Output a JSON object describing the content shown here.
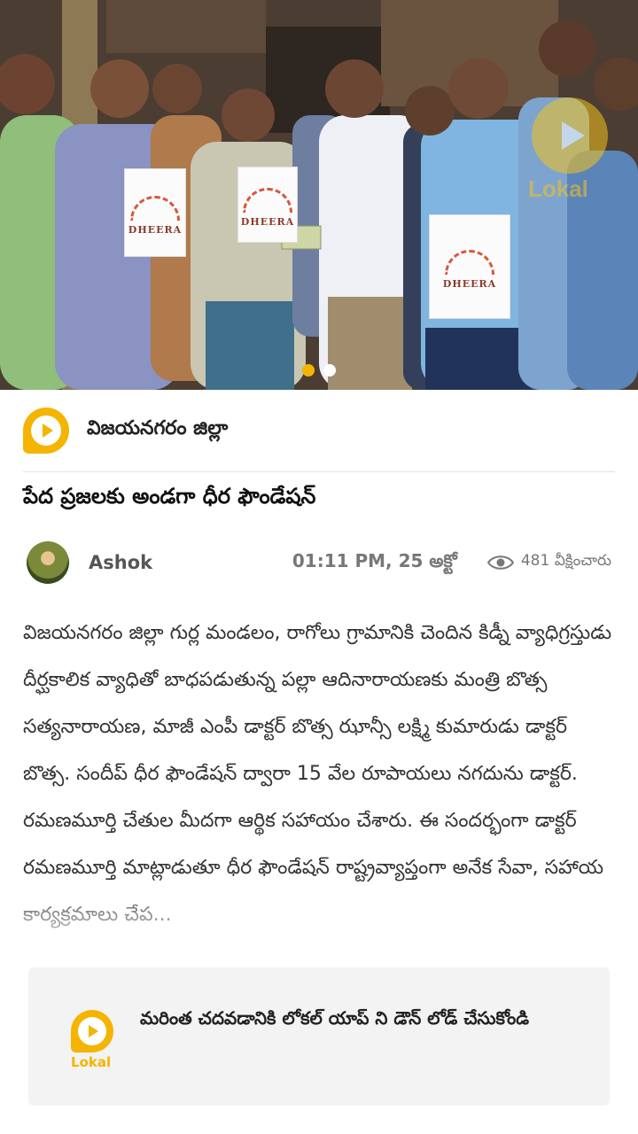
{
  "photo": {
    "description_alt": "",
    "paper_text": "DHEERA",
    "watermark_label": "Lokal",
    "carousel_count": 2,
    "carousel_active": 1
  },
  "category": {
    "label": "విజయనగరం జిల్లా",
    "icon": "lokal-play-icon"
  },
  "headline": "పేద ప్రజలకు అండగా ధీర ఫౌండేషన్",
  "author": {
    "name": "Ashok",
    "time": "01:11 PM, 25 అక్టో",
    "views": "481 వీక్షించారు"
  },
  "article": {
    "body": "విజయనగరం జిల్లా గుర్ల మండలం, రాగోలు గ్రామానికి చెందిన కిడ్నీ వ్యాధిగ్రస్తుడు దీర్ఘకాలిక వ్యాధితో బాధపడుతున్న పల్లా ఆదినారాయణకు మంత్రి బొత్స సత్యనారాయణ, మాజీ ఎంపీ డాక్టర్ బొత్స ఝాన్సీ లక్ష్మి కుమారుడు డాక్టర్ బొత్స. సందీప్ ధీర ఫౌండేషన్ ద్వారా 15 వేల రూపాయలు నగదును డాక్టర్. రమణమూర్తి చేతుల మీదగా ఆర్థిక సహాయం చేశారు. ఈ సందర్భంగా డాక్టర్ రమణమూర్తి మాట్లాడుతూ ధీర ఫౌండేషన్ రాష్ట్రవ్యాప్తంగా అనేక సేవా, సహాయ కార్యక్రమాలు చేప..."
  },
  "banner": {
    "logo_label": "Lokal",
    "text": "మరింత చదవడానికి లోకల్ యాప్ ని డౌన్ లోడ్ చేసుకోండి"
  },
  "colors": {
    "brand": "#f4b400"
  }
}
